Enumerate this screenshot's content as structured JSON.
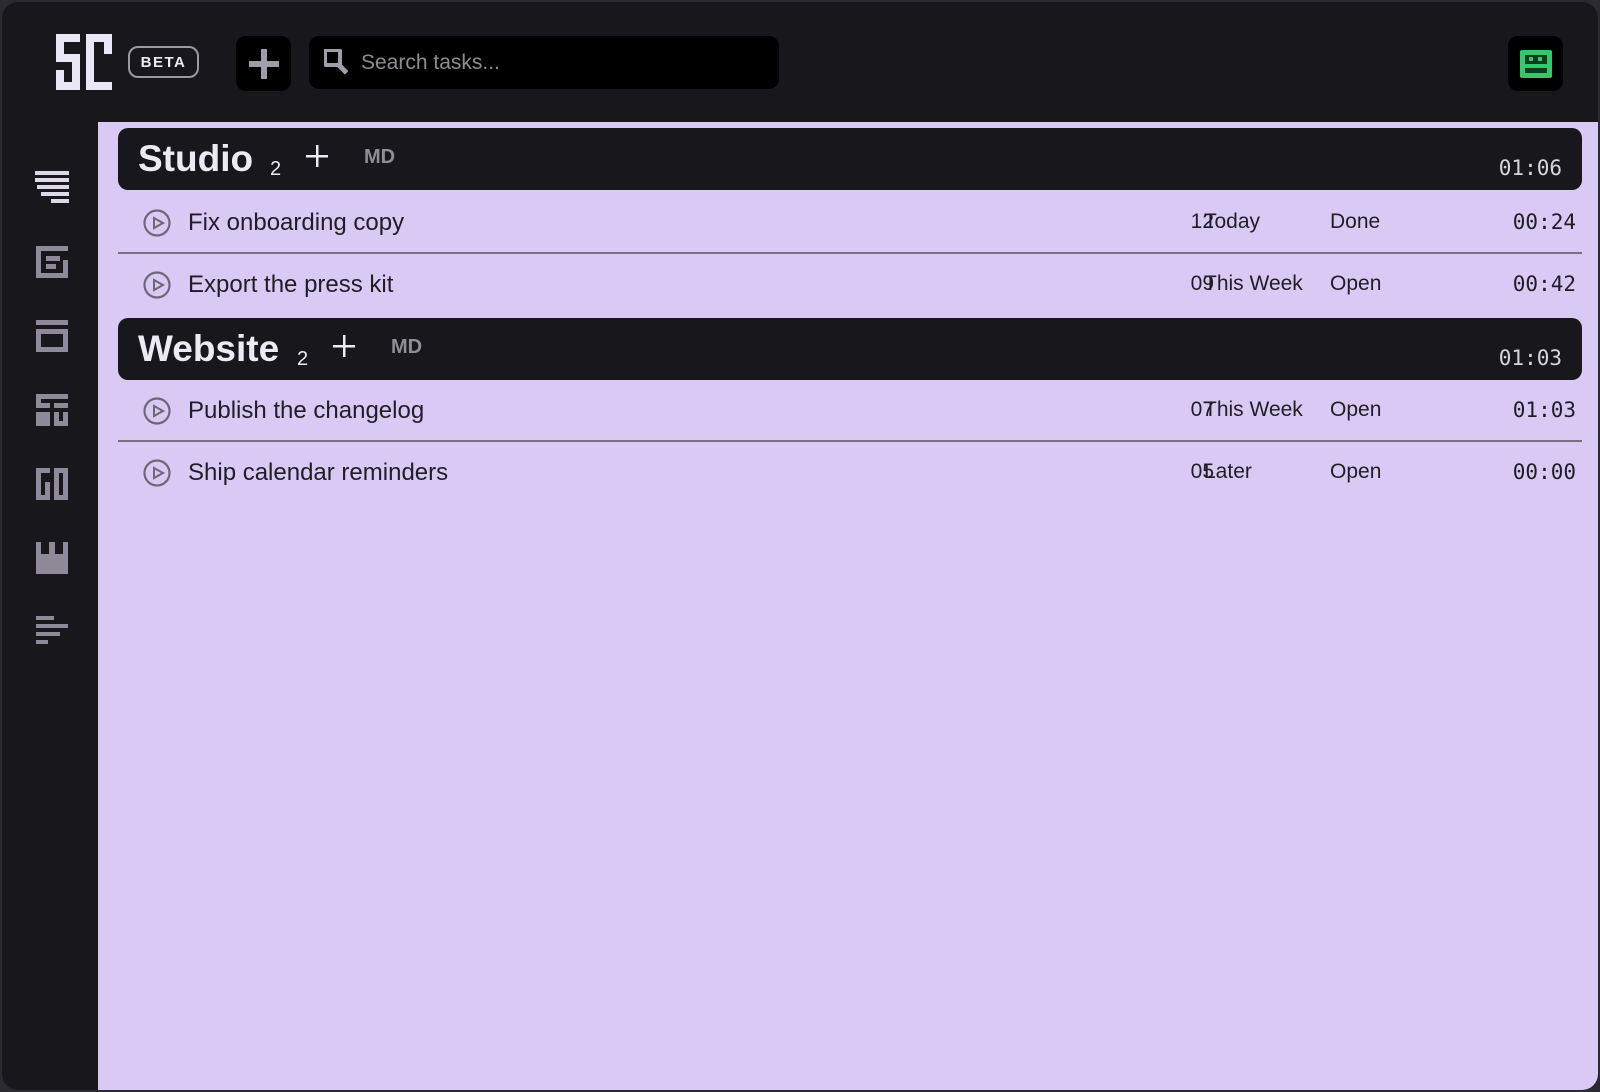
{
  "header": {
    "beta_label": "BETA",
    "search_placeholder": "Search tasks...",
    "add_icon": "plus-icon",
    "user_icon": "user-icon"
  },
  "sidebar": {
    "items": [
      {
        "icon": "list-icon"
      },
      {
        "icon": "document-icon"
      },
      {
        "icon": "archive-icon"
      },
      {
        "icon": "layout-icon"
      },
      {
        "icon": "columns-icon"
      },
      {
        "icon": "calendar-icon"
      },
      {
        "icon": "timeline-icon"
      }
    ]
  },
  "groups": [
    {
      "name": "Studio",
      "count": "2",
      "md_label": "MD",
      "time": "01:06",
      "tasks": [
        {
          "title": "Fix onboarding copy",
          "num": "12",
          "due": "Today",
          "status": "Done",
          "time": "00:24"
        },
        {
          "title": "Export the press kit",
          "num": "09",
          "due": "This Week",
          "status": "Open",
          "time": "00:42"
        }
      ]
    },
    {
      "name": "Website",
      "count": "2",
      "md_label": "MD",
      "time": "01:03",
      "tasks": [
        {
          "title": "Publish the changelog",
          "num": "07",
          "due": "This Week",
          "status": "Open",
          "time": "01:03"
        },
        {
          "title": "Ship calendar reminders",
          "num": "05",
          "due": "Later",
          "status": "Open",
          "time": "00:00"
        }
      ]
    }
  ],
  "colors": {
    "background": "#18171c",
    "content": "#d9caf5",
    "accent_green": "#37c76d"
  }
}
